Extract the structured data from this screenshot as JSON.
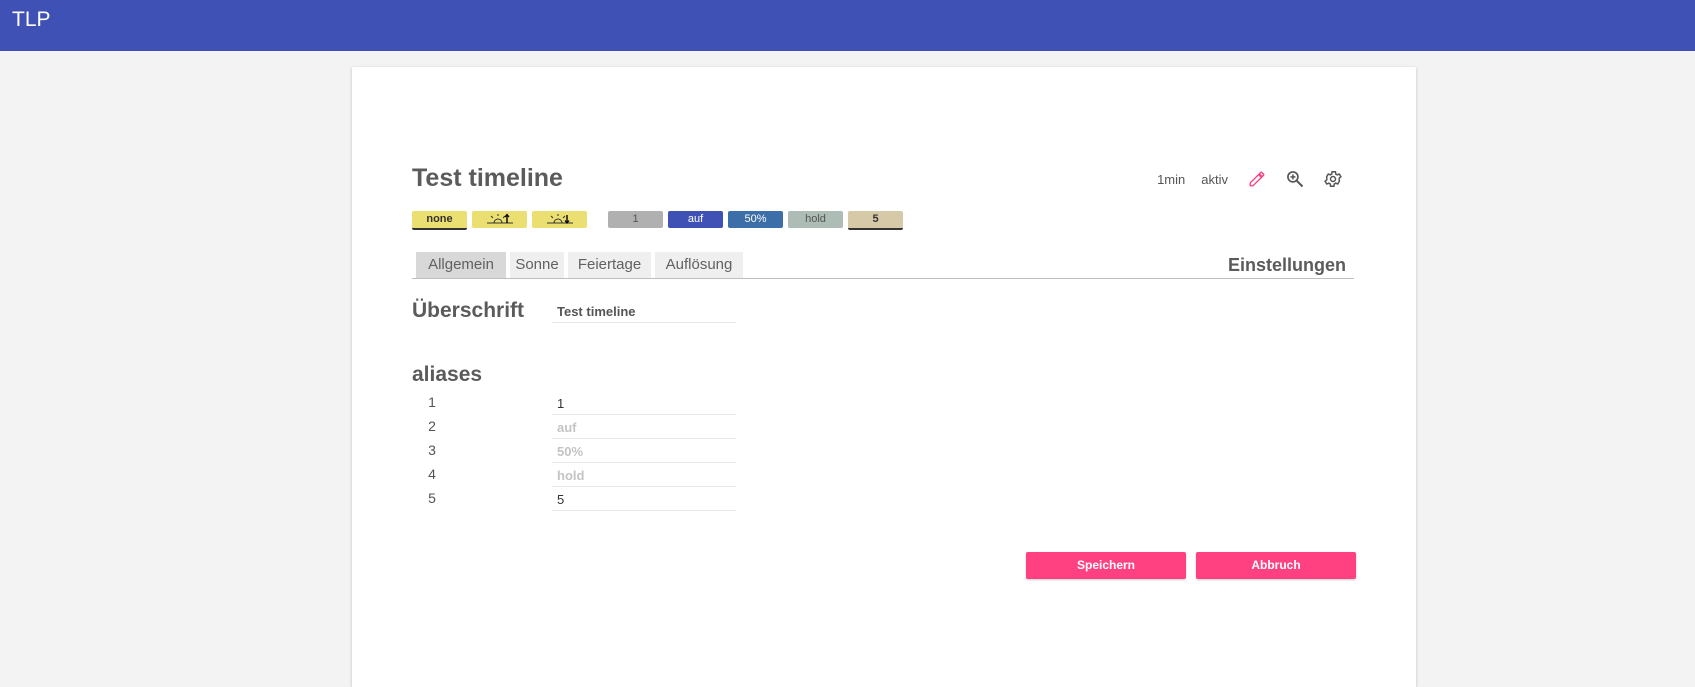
{
  "app": {
    "title": "TLP"
  },
  "timeline": {
    "title": "Test timeline",
    "interval": "1min",
    "status": "aktiv",
    "icons": [
      "pencil-icon",
      "zoom-in-icon",
      "gear-icon"
    ]
  },
  "chips": [
    {
      "label": "none",
      "bg": "#ebdf72",
      "color": "#333",
      "selected": true,
      "icon": ""
    },
    {
      "label": "",
      "bg": "#ebdf72",
      "color": "#333",
      "selected": false,
      "icon": "sunrise-icon"
    },
    {
      "label": "",
      "bg": "#ebdf72",
      "color": "#333",
      "selected": false,
      "icon": "sunset-icon"
    },
    {
      "label": "1",
      "bg": "#b0b0b0",
      "color": "#555",
      "selected": false,
      "icon": ""
    },
    {
      "label": "auf",
      "bg": "#3f51b5",
      "color": "#fff",
      "selected": false,
      "icon": ""
    },
    {
      "label": "50%",
      "bg": "#3c6fa8",
      "color": "#fff",
      "selected": false,
      "icon": ""
    },
    {
      "label": "hold",
      "bg": "#aebcb6",
      "color": "#555",
      "selected": false,
      "icon": ""
    },
    {
      "label": "5",
      "bg": "#d6c9a8",
      "color": "#333",
      "selected": true,
      "icon": ""
    }
  ],
  "tabs": [
    {
      "label": "Allgemein",
      "active": true
    },
    {
      "label": "Sonne",
      "active": false
    },
    {
      "label": "Feiertage",
      "active": false
    },
    {
      "label": "Auflösung",
      "active": false
    }
  ],
  "settings": {
    "section_title": "Einstellungen",
    "heading_label": "Überschrift",
    "heading_value": "Test timeline",
    "aliases_label": "aliases",
    "aliases": [
      {
        "num": "1",
        "value": "1",
        "placeholder": ""
      },
      {
        "num": "2",
        "value": "",
        "placeholder": "auf"
      },
      {
        "num": "3",
        "value": "",
        "placeholder": "50%"
      },
      {
        "num": "4",
        "value": "",
        "placeholder": "hold"
      },
      {
        "num": "5",
        "value": "5",
        "placeholder": ""
      }
    ]
  },
  "buttons": {
    "save": "Speichern",
    "cancel": "Abbruch"
  },
  "colors": {
    "appbar": "#3f51b5",
    "accent": "#ff4081"
  }
}
